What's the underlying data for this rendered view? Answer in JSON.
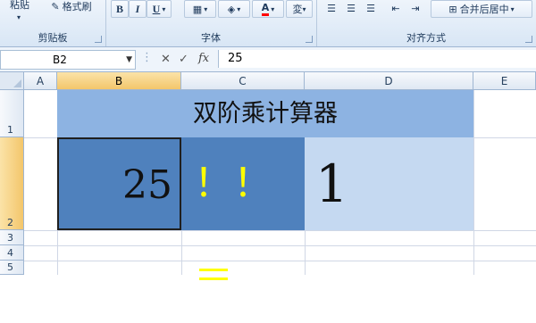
{
  "ribbon": {
    "clipboard": {
      "paste_label": "粘贴",
      "format_painter_label": "格式刷",
      "group_label": "剪贴板"
    },
    "font": {
      "bold": "B",
      "italic": "I",
      "underline": "U",
      "group_label": "字体"
    },
    "alignment": {
      "merge_label": "合并后居中",
      "group_label": "对齐方式"
    }
  },
  "formula_bar": {
    "name_box": "B2",
    "cancel_symbol": "✕",
    "enter_symbol": "✓",
    "fx_label": "fx",
    "value": "25"
  },
  "grid": {
    "columns": [
      "A",
      "B",
      "C",
      "D",
      "E"
    ],
    "rows": [
      "1",
      "2",
      "3",
      "4",
      "5"
    ],
    "selected_cell": "B2",
    "cells": {
      "title": "双阶乘计算器",
      "b2": "25",
      "c2": "！！＝",
      "d2": "1"
    }
  },
  "colors": {
    "header_fill": "#8db3e2",
    "input_fill": "#4f81bd",
    "result_fill": "#c5d9f1",
    "operator_text": "#ffff00",
    "selection_header": "#f3c66b"
  }
}
